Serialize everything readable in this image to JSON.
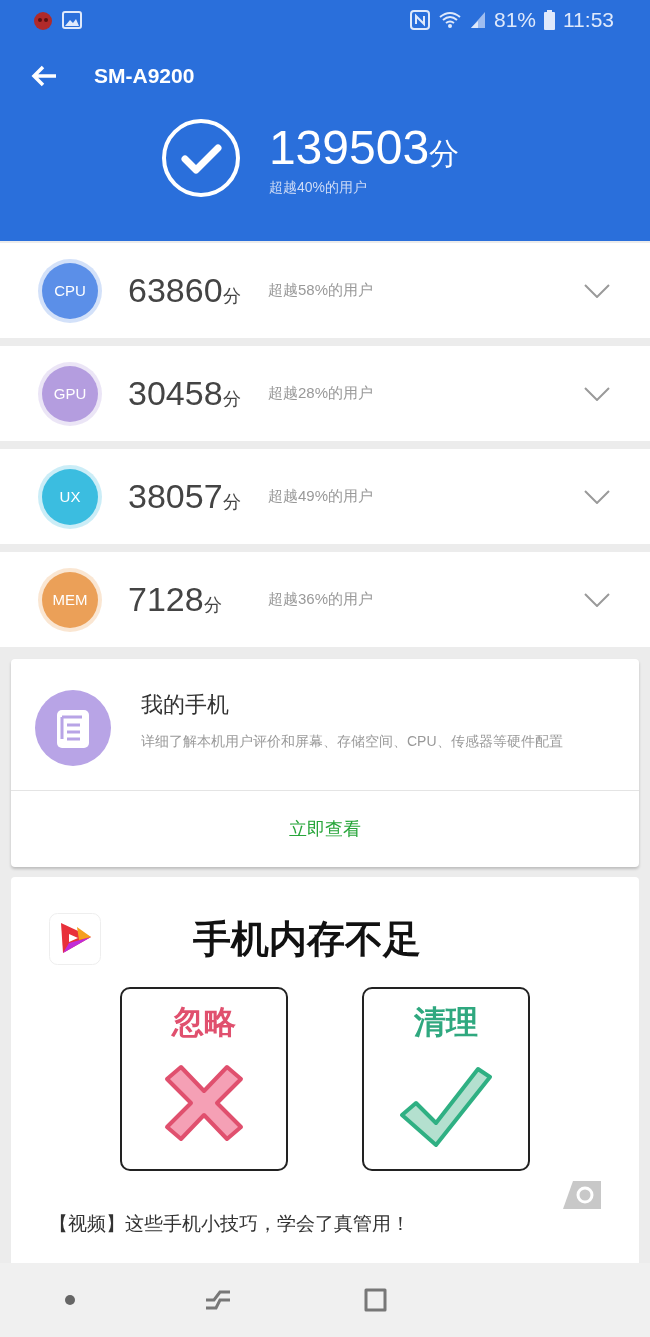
{
  "status_bar": {
    "battery": "81%",
    "time": "11:53"
  },
  "header": {
    "title": "SM-A9200",
    "total_score": "139503",
    "unit": "分",
    "subtitle": "超越40%的用户"
  },
  "scores": [
    {
      "label": "CPU",
      "score": "63860",
      "unit": "分",
      "rank": "超越58%的用户",
      "color": "#5b8fe8"
    },
    {
      "label": "GPU",
      "score": "30458",
      "unit": "分",
      "rank": "超越28%的用户",
      "color": "#b49ddf"
    },
    {
      "label": "UX",
      "score": "38057",
      "unit": "分",
      "rank": "超越49%的用户",
      "color": "#3bbde0"
    },
    {
      "label": "MEM",
      "score": "7128",
      "unit": "分",
      "rank": "超越36%的用户",
      "color": "#eba058"
    }
  ],
  "my_phone_card": {
    "title": "我的手机",
    "description": "详细了解本机用户评价和屏幕、存储空间、CPU、传感器等硬件配置",
    "action": "立即查看"
  },
  "ad": {
    "headline": "手机内存不足",
    "options": [
      {
        "label": "忽略",
        "kind": "cross"
      },
      {
        "label": "清理",
        "kind": "check"
      }
    ],
    "caption": "【视频】这些手机小技巧，学会了真管用！"
  }
}
